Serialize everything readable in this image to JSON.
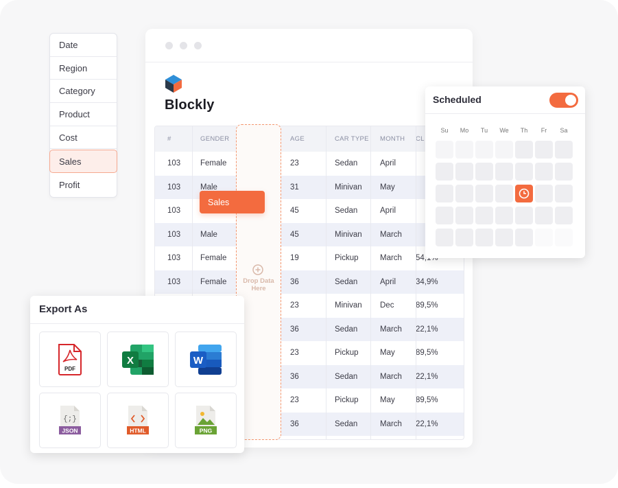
{
  "fields": [
    "Date",
    "Region",
    "Category",
    "Product",
    "Cost",
    "Sales",
    "Profit"
  ],
  "active_field": "Sales",
  "brand": {
    "name": "Blockly",
    "colors": [
      "#2f8fd8",
      "#f36b3f",
      "#2b3a4a"
    ]
  },
  "table": {
    "headers": [
      "#",
      "GENDER",
      "AGE",
      "CAR TYPE",
      "MONTH",
      "CL"
    ],
    "rows": [
      [
        "103",
        "Female",
        "23",
        "Sedan",
        "April",
        ""
      ],
      [
        "103",
        "Male",
        "31",
        "Minivan",
        "May",
        ""
      ],
      [
        "103",
        "",
        "45",
        "Sedan",
        "April",
        ""
      ],
      [
        "103",
        "Male",
        "45",
        "Minivan",
        "March",
        ""
      ],
      [
        "103",
        "Female",
        "19",
        "Pickup",
        "March",
        "54,1%"
      ],
      [
        "103",
        "Female",
        "36",
        "Sedan",
        "April",
        "34,9%"
      ],
      [
        "",
        "",
        "23",
        "Minivan",
        "Dec",
        "89,5%"
      ],
      [
        "",
        "",
        "36",
        "Sedan",
        "March",
        "22,1%"
      ],
      [
        "",
        "",
        "23",
        "Pickup",
        "May",
        "89,5%"
      ],
      [
        "",
        "",
        "36",
        "Sedan",
        "March",
        "22,1%"
      ],
      [
        "",
        "",
        "23",
        "Pickup",
        "May",
        "89,5%"
      ],
      [
        "",
        "",
        "36",
        "Sedan",
        "March",
        "22,1%"
      ]
    ]
  },
  "drag_chip": "Sales",
  "dropzone": {
    "text": "Drop Data Here",
    "icon": "plus-circle-icon"
  },
  "scheduled": {
    "title": "Scheduled",
    "toggle_on": true,
    "days": [
      "Su",
      "Mo",
      "Tu",
      "We",
      "Th",
      "Fr",
      "Sa"
    ],
    "selected_icon": "clock-icon",
    "accent": "#f36b3f"
  },
  "export": {
    "title": "Export As",
    "formats": [
      {
        "label": "PDF",
        "icon": "pdf-file-icon",
        "color": "#d6262a"
      },
      {
        "label": "X",
        "icon": "excel-icon",
        "color": "#1d7a44"
      },
      {
        "label": "W",
        "icon": "word-icon",
        "color": "#1f5fbf"
      },
      {
        "label": "JSON",
        "icon": "json-file-icon",
        "color": "#8b5c9e"
      },
      {
        "label": "HTML",
        "icon": "html-file-icon",
        "color": "#e05b2a"
      },
      {
        "label": "PNG",
        "icon": "png-file-icon",
        "color": "#6aa335"
      }
    ]
  }
}
